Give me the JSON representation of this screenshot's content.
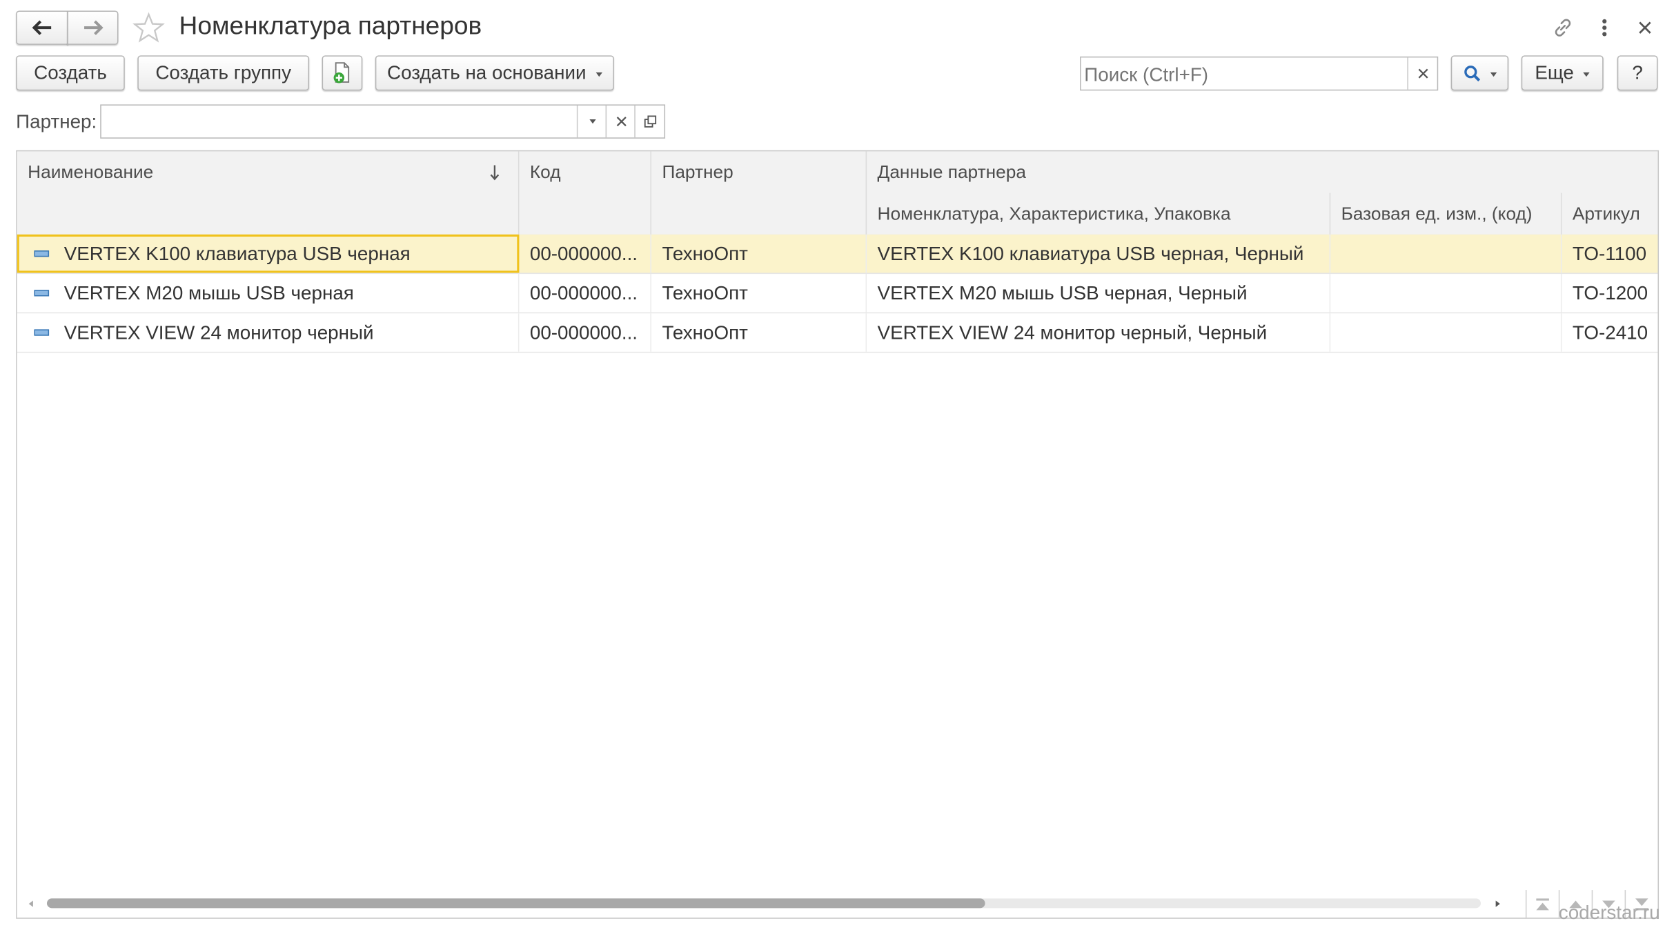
{
  "window": {
    "title": "Номенклатура партнеров"
  },
  "toolbar": {
    "create_label": "Создать",
    "create_group_label": "Создать группу",
    "create_based_on_label": "Создать на основании",
    "search_placeholder": "Поиск (Ctrl+F)",
    "more_label": "Еще",
    "help_label": "?"
  },
  "filter": {
    "partner_label": "Партнер:",
    "partner_value": ""
  },
  "table": {
    "columns": {
      "name": "Наименование",
      "code": "Код",
      "partner": "Партнер",
      "partner_data": "Данные партнера",
      "nomenclature": "Номенклатура, Характеристика, Упаковка",
      "base_unit": "Базовая ед. изм., (код)",
      "article": "Артикул"
    },
    "rows": [
      {
        "name": "VERTEX K100 клавиатура USB черная",
        "code": "00-000000...",
        "partner": "ТехноОпт",
        "nomenclature": "VERTEX K100 клавиатура USB черная, Черный",
        "base_unit": "",
        "article": "TO-1100"
      },
      {
        "name": "VERTEX M20 мышь USB черная",
        "code": "00-000000...",
        "partner": "ТехноОпт",
        "nomenclature": "VERTEX M20 мышь USB черная, Черный",
        "base_unit": "",
        "article": "TO-1200"
      },
      {
        "name": "VERTEX VIEW 24 монитор черный",
        "code": "00-000000...",
        "partner": "ТехноОпт",
        "nomenclature": "VERTEX VIEW 24 монитор черный, Черный",
        "base_unit": "",
        "article": "TO-2410"
      }
    ]
  },
  "footer": {
    "watermark": "coderstar.ru"
  },
  "colors": {
    "selected_row": "#fbf3cb",
    "focus_border": "#f0c21c",
    "search_accent": "#2a6bb8"
  },
  "icons": [
    "arrow-left-icon",
    "arrow-right-icon",
    "star-icon",
    "link-icon",
    "more-vertical-icon",
    "close-icon",
    "copy-document-icon",
    "search-icon",
    "dropdown-icon",
    "clear-icon",
    "open-icon",
    "sort-down-icon",
    "item-icon"
  ]
}
